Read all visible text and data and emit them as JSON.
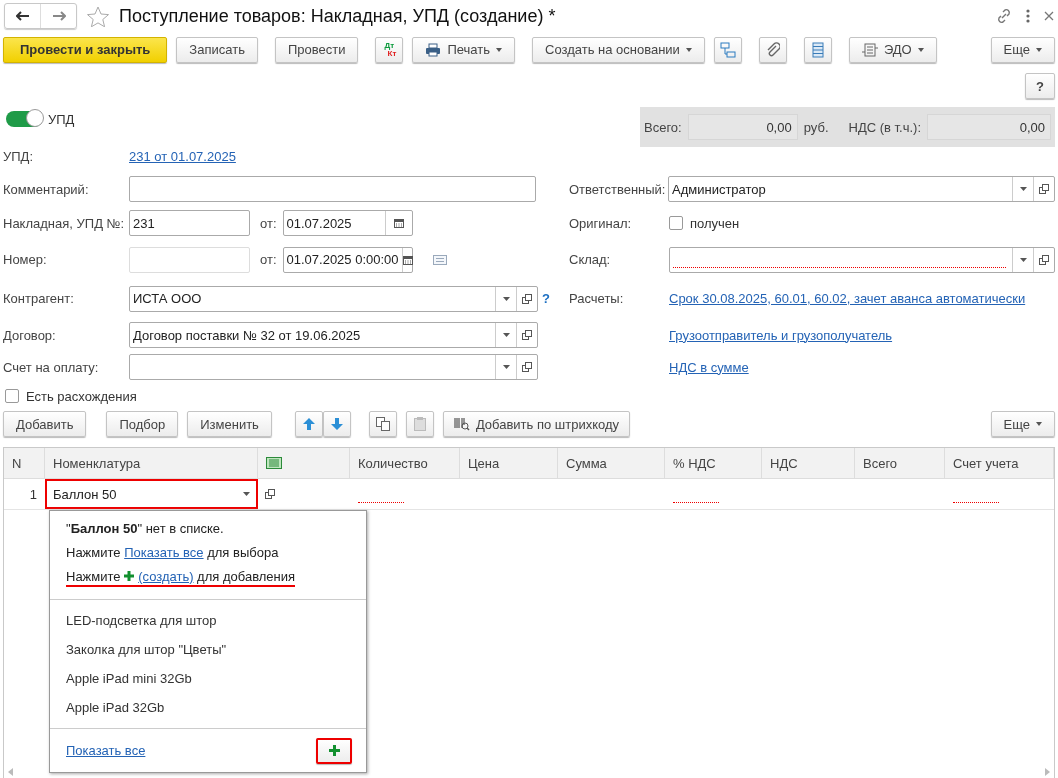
{
  "window": {
    "title": "Поступление товаров: Накладная, УПД (создание) *"
  },
  "toolbar": {
    "primary": "Провести и закрыть",
    "buttons": [
      "Записать",
      "Провести"
    ],
    "dtkt": {
      "debit": "Дт",
      "credit": "Кт"
    },
    "print_menu": "Печать",
    "create_based_menu": "Создать на основании",
    "edo_menu": "ЭДО",
    "more_menu": "Еще"
  },
  "help_button": "?",
  "upd_toggle": {
    "label": "УПД",
    "on": true
  },
  "totals": {
    "total_label": "Всего:",
    "total": "0,00",
    "currency": "руб.",
    "vat_label": "НДС (в т.ч.):",
    "vat": "0,00"
  },
  "form_rows": [
    {
      "left": {
        "kind": "link",
        "label": "УПД:",
        "value": "231 от 01.07.2025"
      }
    },
    {
      "left": {
        "kind": "input",
        "label": "Комментарий:"
      },
      "right": {
        "kind": "select",
        "label": "Ответственный:",
        "value": "Администратор",
        "required": false
      }
    },
    {
      "left": {
        "kind": "number-date",
        "label": "Накладная, УПД №:",
        "value": "231",
        "disabled": false,
        "date_label": "от:",
        "date": "01.07.2025"
      },
      "right": {
        "kind": "checkbox",
        "label": "Оригинал:",
        "option": "получен",
        "checked": false
      }
    },
    {
      "left": {
        "kind": "number-datetime",
        "label": "Номер:",
        "disabled": true,
        "date_label": "от:",
        "date": "01.07.2025  0:00:00"
      },
      "right": {
        "kind": "select",
        "label": "Склад:",
        "required": true
      }
    },
    {
      "left": {
        "kind": "select",
        "label": "Контрагент:",
        "value": "ИСТА ООО",
        "help": "?",
        "required": false
      },
      "right": {
        "kind": "link",
        "label": "Расчеты:",
        "value": "Срок 30.08.2025, 60.01, 60.02, зачет аванса автоматически"
      }
    },
    {
      "left": {
        "kind": "select",
        "label": "Договор:",
        "value": "Договор поставки № 32 от 19.06.2025",
        "required": false
      },
      "right": {
        "kind": "link",
        "value": "Грузоотправитель и грузополучатель"
      }
    },
    {
      "left": {
        "kind": "select",
        "label": "Счет на оплату:",
        "required": false
      },
      "right": {
        "kind": "link",
        "value": "НДС в сумме"
      }
    },
    {
      "left": {
        "kind": "checkbox",
        "option": "Есть расхождения",
        "checked": false
      }
    }
  ],
  "table_toolbar": {
    "add": "Добавить",
    "pick": "Подбор",
    "edit": "Изменить",
    "barcode": "Добавить по штрихкоду",
    "more": "Еще"
  },
  "table": {
    "columns": [
      {
        "kind": "text",
        "label": "N"
      },
      {
        "kind": "text",
        "label": "Номенклатура"
      },
      {
        "kind": "icon"
      },
      {
        "kind": "text",
        "label": "Количество"
      },
      {
        "kind": "text",
        "label": "Цена"
      },
      {
        "kind": "text",
        "label": "Сумма"
      },
      {
        "kind": "text",
        "label": "% НДС"
      },
      {
        "kind": "text",
        "label": "НДС"
      },
      {
        "kind": "text",
        "label": "Всего"
      },
      {
        "kind": "text",
        "label": "Счет учета"
      }
    ],
    "rows": [
      {
        "cells": [
          {
            "text": "1",
            "required": false
          },
          {
            "text": "Баллон 50",
            "editing": true,
            "highlighted": true,
            "required": false
          },
          {
            "required": false
          },
          {
            "required": true
          },
          {
            "required": false
          },
          {
            "required": false
          },
          {
            "required": true
          },
          {
            "required": false
          },
          {
            "required": false
          },
          {
            "required": true
          }
        ]
      }
    ]
  },
  "popup": {
    "message": "\"**Баллон 50**\" нет в списке.",
    "hint_show": {
      "before": "Нажмите",
      "link": "Показать все",
      "after": "для выбора",
      "underlined": false
    },
    "hint_create": {
      "before": "Нажмите",
      "link": "(создать)",
      "after": "для добавления",
      "underlined": true
    },
    "items": [
      "LED-подсветка для штор",
      "Заколка для штор \"Цветы\"",
      "Apple iPad mini 32Gb",
      "Apple iPad 32Gb"
    ],
    "show_all": "Показать все",
    "add_button": {
      "highlighted": true
    }
  }
}
